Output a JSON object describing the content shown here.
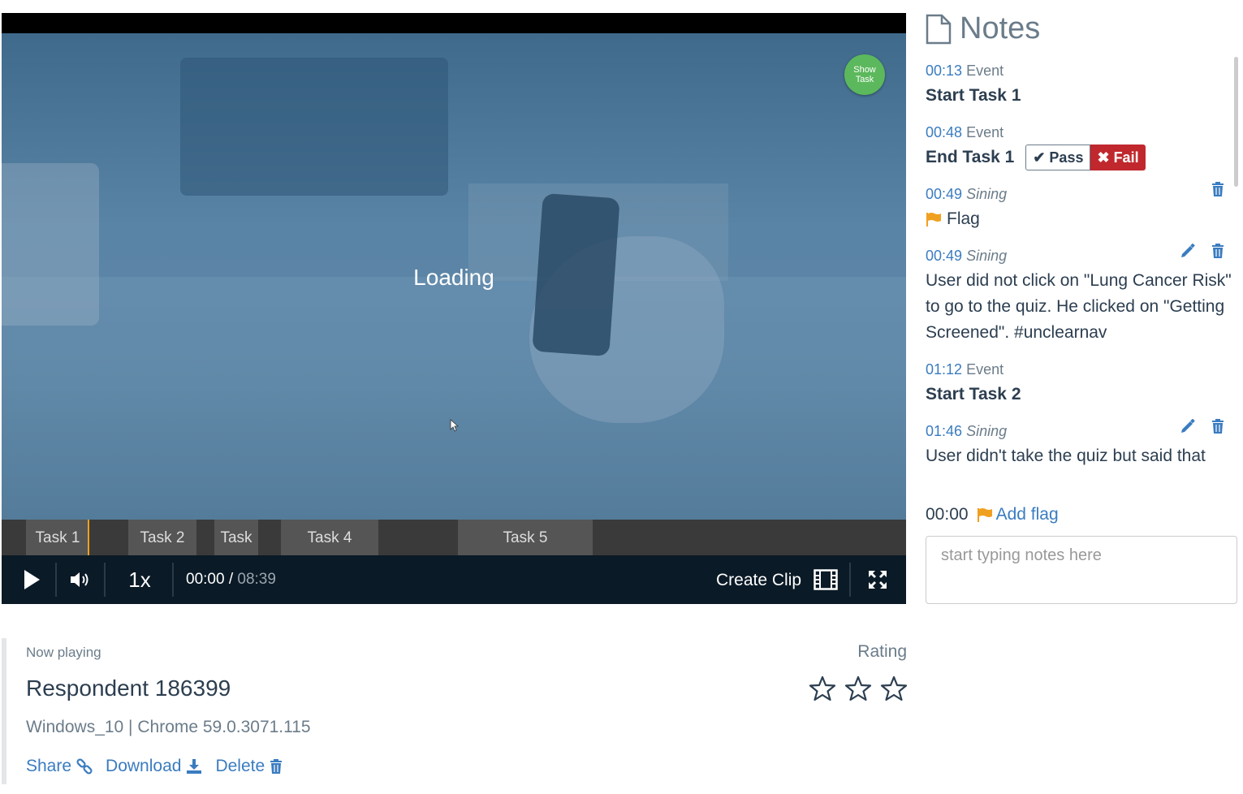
{
  "player": {
    "loading_text": "Loading",
    "show_task_label": "Show Task",
    "tasks": [
      {
        "label": "Task 1"
      },
      {
        "label": "Task 2"
      },
      {
        "label": "Task"
      },
      {
        "label": "Task 4"
      },
      {
        "label": "Task 5"
      }
    ],
    "speed": "1x",
    "current_time": "00:00",
    "separator": " / ",
    "duration": "08:39",
    "create_clip_label": "Create Clip"
  },
  "notes": {
    "title": "Notes",
    "items": [
      {
        "ts": "00:13",
        "who": "Event",
        "text": "Start Task 1"
      },
      {
        "ts": "00:48",
        "who": "Event",
        "text": "End Task 1",
        "pass_label": "Pass",
        "fail_label": "Fail"
      },
      {
        "ts": "00:49",
        "who": "Sining",
        "text": "Flag"
      },
      {
        "ts": "00:49",
        "who": "Sining",
        "text": "User did not click on \"Lung Cancer Risk\" to go to the quiz. He clicked on \"Getting Screened\". #unclearnav"
      },
      {
        "ts": "01:12",
        "who": "Event",
        "text": "Start Task 2"
      },
      {
        "ts": "01:46",
        "who": "Sining",
        "text": "User didn't take the quiz but said that"
      }
    ],
    "add_time": "00:00",
    "add_flag_label": "Add flag",
    "input_placeholder": "start typing notes here"
  },
  "session": {
    "now_playing_label": "Now playing",
    "respondent": "Respondent 186399",
    "system": "Windows_10 | Chrome 59.0.3071.115",
    "rating_label": "Rating",
    "share_label": "Share",
    "download_label": "Download",
    "delete_label": "Delete"
  },
  "colors": {
    "accent": "#3a7cc0",
    "fail": "#c0282d",
    "flag": "#f0a020",
    "show_task": "#5cb85c"
  }
}
